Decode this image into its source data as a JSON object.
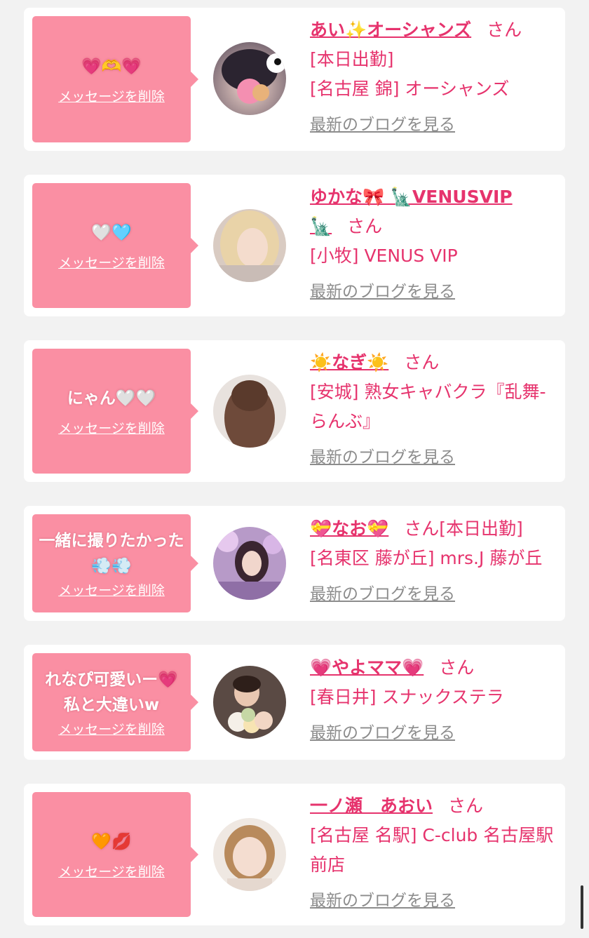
{
  "ui": {
    "delete_label": "メッセージを削除",
    "blog_label": "最新のブログを見る",
    "san_label": "さん"
  },
  "colors": {
    "background": "#f2f2f2",
    "card": "#ffffff",
    "bubble": "#fa8fa3",
    "accent_pink": "#e6336d",
    "link_gray": "#8c8c8c"
  },
  "entries": [
    {
      "message": "💗🫶💗",
      "name": "あい✨オーシャンズ",
      "lines": [
        "[本日出勤]",
        "[名古屋 錦] オーシャンズ"
      ]
    },
    {
      "message": "🤍🩵",
      "name": "ゆかな🎀 🗽VENUSVIP 🗽",
      "lines": [
        "[小牧] VENUS VIP"
      ]
    },
    {
      "message": "にゃん🤍🤍",
      "name": "☀️なぎ☀️",
      "lines": [
        "[安城] 熟女キャバクラ『乱舞-らんぶ』"
      ]
    },
    {
      "message": "一緒に撮りたかった💨💨",
      "name": "💝なお💝",
      "after_san": "[本日出勤]",
      "lines": [
        "[名東区 藤が丘] mrs.J 藤が丘"
      ]
    },
    {
      "message": "れなぴ可愛いー💗私と大違いw",
      "name": "💗やよママ💗",
      "lines": [
        "[春日井] スナックステラ"
      ]
    },
    {
      "message": "🧡💋",
      "name": "一ノ瀬　あおい",
      "lines": [
        "[名古屋 名駅] C-club 名古屋駅前店"
      ]
    }
  ]
}
